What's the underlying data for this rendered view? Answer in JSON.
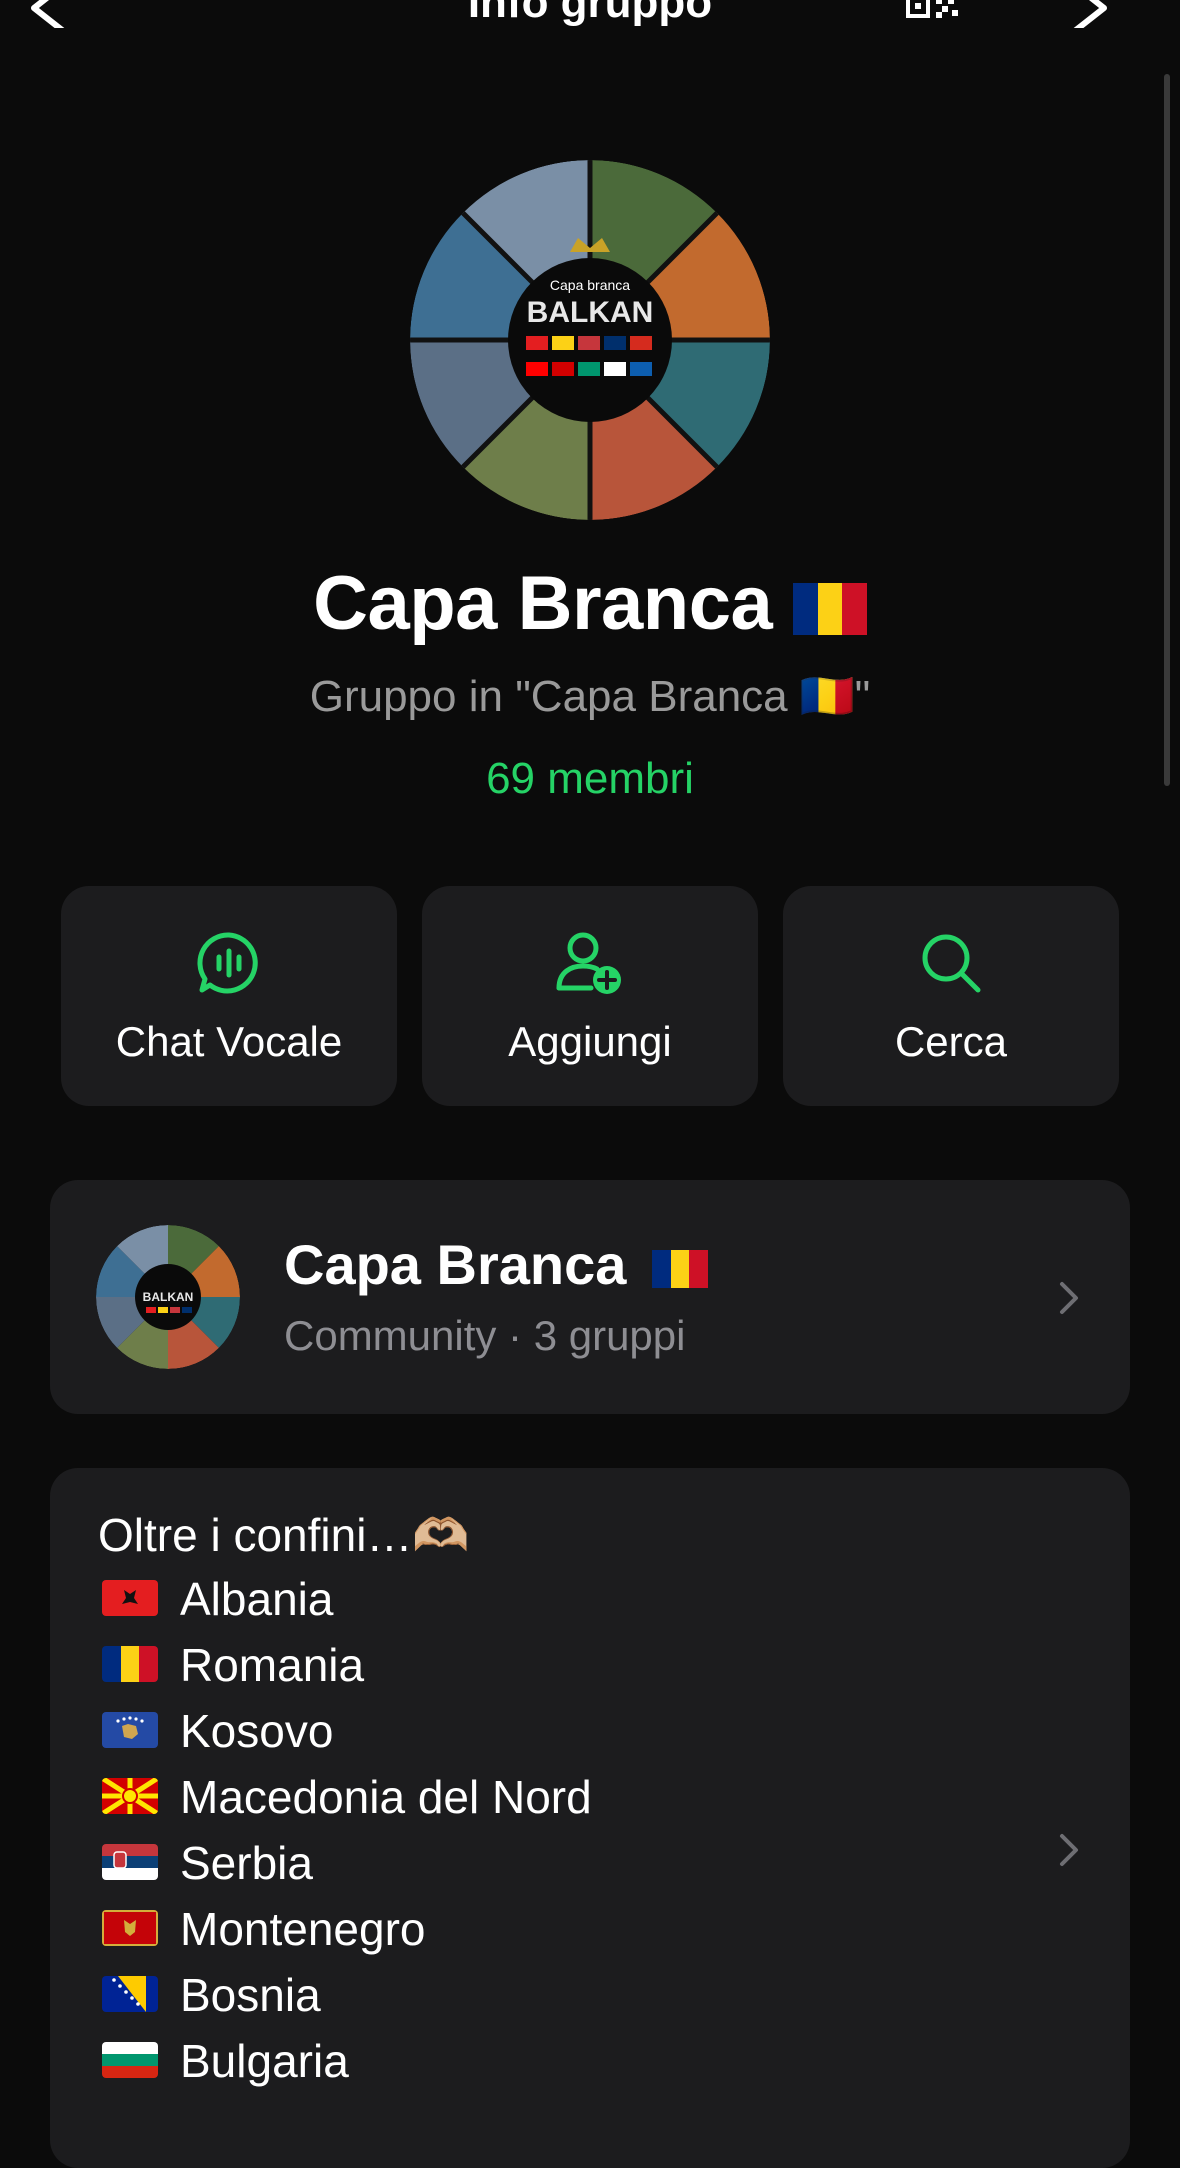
{
  "header": {
    "title": "Info gruppo"
  },
  "group": {
    "name": "Capa Branca",
    "subtitle": "Gruppo in \"Capa Branca 🇷🇴\"",
    "members": "69 membri"
  },
  "actions": [
    {
      "label": "Chat Vocale",
      "icon": "voice-chat-icon"
    },
    {
      "label": "Aggiungi",
      "icon": "add-person-icon"
    },
    {
      "label": "Cerca",
      "icon": "search-icon"
    }
  ],
  "community": {
    "name": "Capa Branca",
    "meta": "Community · 3 gruppi"
  },
  "description": {
    "intro": "Oltre i confini…🫶🏼",
    "countries": [
      "Albania",
      "Romania",
      "Kosovo",
      "Macedonia del Nord",
      "Serbia",
      "Montenegro",
      "Bosnia",
      "Bulgaria"
    ]
  },
  "avatar_text": {
    "line1": "Capa branca",
    "line2": "BALKAN"
  },
  "colors": {
    "accent": "#25d366",
    "card": "#1c1c1e",
    "background": "#0b0b0b"
  }
}
